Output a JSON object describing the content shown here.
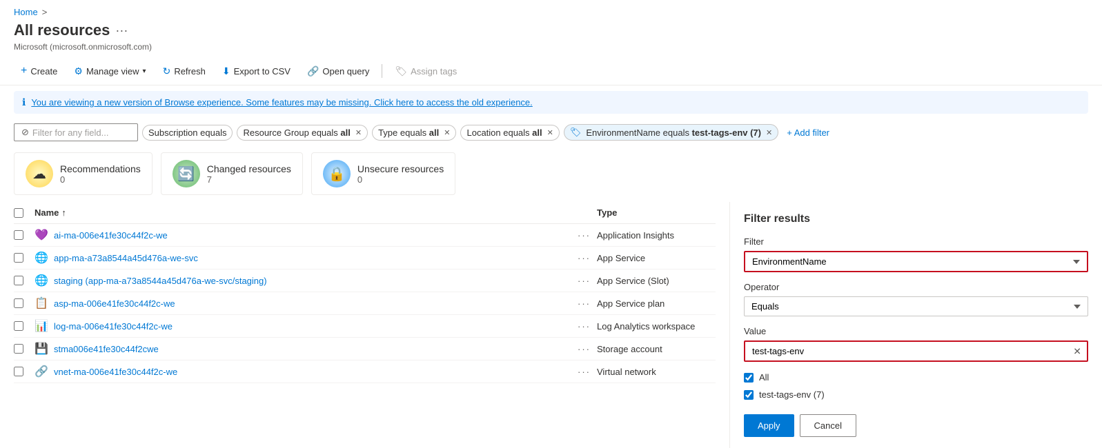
{
  "breadcrumb": {
    "home": "Home",
    "separator": ">"
  },
  "page": {
    "title": "All resources",
    "dots": "···",
    "subtitle": "Microsoft (microsoft.onmicrosoft.com)"
  },
  "toolbar": {
    "create": "Create",
    "manage_view": "Manage view",
    "refresh": "Refresh",
    "export": "Export to CSV",
    "open_query": "Open query",
    "assign_tags": "Assign tags"
  },
  "info_banner": {
    "icon": "ℹ",
    "text": "You are viewing a new version of Browse experience. Some features may be missing. Click here to access the old experience."
  },
  "filter_bar": {
    "placeholder": "Filter for any field...",
    "tags": [
      {
        "label": "Subscription equals",
        "value": "",
        "closable": false
      },
      {
        "label": "Resource Group equals",
        "value": "all",
        "closable": true
      },
      {
        "label": "Type equals",
        "value": "all",
        "closable": true
      },
      {
        "label": "Location equals",
        "value": "all",
        "closable": true
      }
    ],
    "special_tag": {
      "icon": "🏷",
      "label": "EnvironmentName equals",
      "value": "test-tags-env (7)",
      "closable": true
    },
    "add_filter": "+ Add filter"
  },
  "summary_cards": [
    {
      "icon": "☁",
      "label": "Recommendations",
      "count": "0",
      "type": "reco"
    },
    {
      "icon": "🔄",
      "label": "Changed resources",
      "count": "7",
      "type": "changed"
    },
    {
      "icon": "🔒",
      "label": "Unsecure resources",
      "count": "0",
      "type": "unsecure"
    }
  ],
  "table": {
    "col_name": "Name",
    "sort_icon": "↑",
    "col_type": "Type",
    "rows": [
      {
        "icon": "💜",
        "name": "ai-ma-006e41fe30c44f2c-we",
        "type": "Application Insights"
      },
      {
        "icon": "🌐",
        "name": "app-ma-a73a8544a45d476a-we-svc",
        "type": "App Service"
      },
      {
        "icon": "🌐",
        "name": "staging (app-ma-a73a8544a45d476a-we-svc/staging)",
        "type": "App Service (Slot)"
      },
      {
        "icon": "📋",
        "name": "asp-ma-006e41fe30c44f2c-we",
        "type": "App Service plan"
      },
      {
        "icon": "📊",
        "name": "log-ma-006e41fe30c44f2c-we",
        "type": "Log Analytics workspace"
      },
      {
        "icon": "💾",
        "name": "stma006e41fe30c44f2cwe",
        "type": "Storage account"
      },
      {
        "icon": "🔗",
        "name": "vnet-ma-006e41fe30c44f2c-we",
        "type": "Virtual network"
      }
    ]
  },
  "filter_panel": {
    "title": "Filter results",
    "filter_label": "Filter",
    "filter_value": "EnvironmentName",
    "operator_label": "Operator",
    "operator_value": "Equals",
    "value_label": "Value",
    "value_input": "test-tags-env",
    "checkboxes": [
      {
        "label": "All",
        "checked": true
      },
      {
        "label": "test-tags-env (7)",
        "checked": true
      }
    ],
    "apply_btn": "Apply",
    "cancel_btn": "Cancel"
  }
}
